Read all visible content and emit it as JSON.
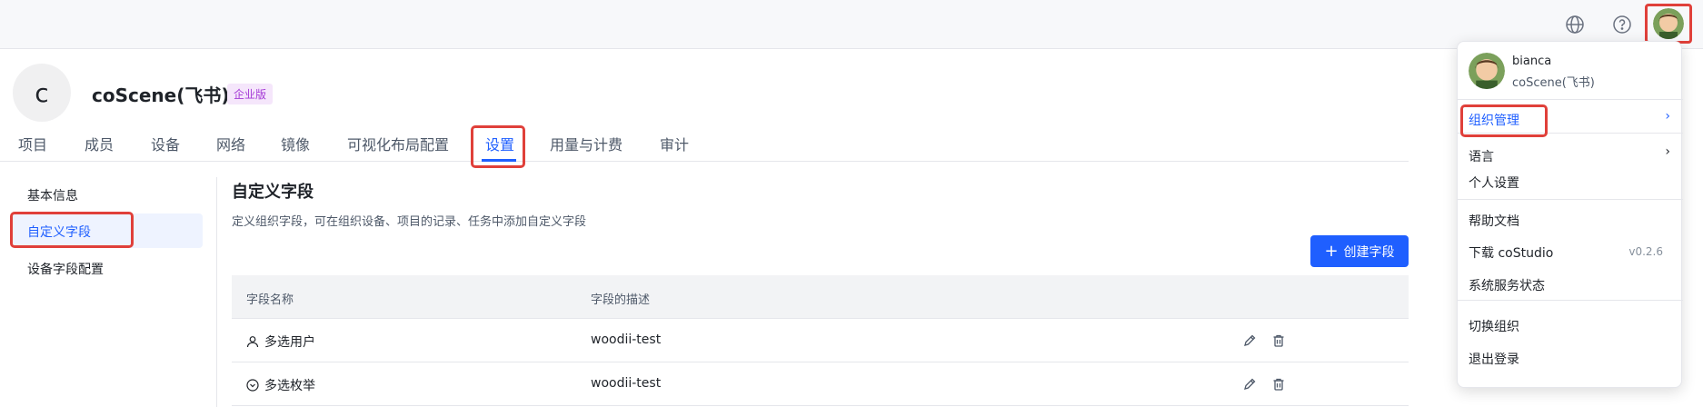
{
  "org": {
    "logo_letter": "c",
    "name": "coScene(飞书)",
    "edition_badge": "企业版"
  },
  "tabs": [
    {
      "label": "项目"
    },
    {
      "label": "成员"
    },
    {
      "label": "设备"
    },
    {
      "label": "网络"
    },
    {
      "label": "镜像"
    },
    {
      "label": "可视化布局配置"
    },
    {
      "label": "设置"
    },
    {
      "label": "用量与计费"
    },
    {
      "label": "审计"
    }
  ],
  "active_tab": "设置",
  "sidebar": {
    "items": [
      {
        "label": "基本信息"
      },
      {
        "label": "自定义字段"
      },
      {
        "label": "设备字段配置"
      }
    ],
    "active": "自定义字段"
  },
  "section": {
    "title": "自定义字段",
    "description": "定义组织字段，可在组织设备、项目的记录、任务中添加自定义字段",
    "create_button": "创建字段"
  },
  "table": {
    "columns": [
      "字段名称",
      "字段的描述"
    ],
    "rows": [
      {
        "icon": "user-icon",
        "name": "多选用户",
        "description": "woodii-test"
      },
      {
        "icon": "chevron-circle-icon",
        "name": "多选枚举",
        "description": "woodii-test"
      }
    ]
  },
  "user_menu": {
    "username": "bianca",
    "org_name": "coScene(飞书)",
    "org_manage": "组织管理",
    "language": "语言",
    "personal_settings": "个人设置",
    "help_docs": "帮助文档",
    "download": "下载 coStudio",
    "version": "v0.2.6",
    "system_status": "系统服务状态",
    "switch_org": "切换组织",
    "logout": "退出登录"
  },
  "colors": {
    "accent": "#1f5fff",
    "highlight": "#e0403a",
    "badge_bg": "#f5e6fb",
    "badge_text": "#a53ad6"
  }
}
